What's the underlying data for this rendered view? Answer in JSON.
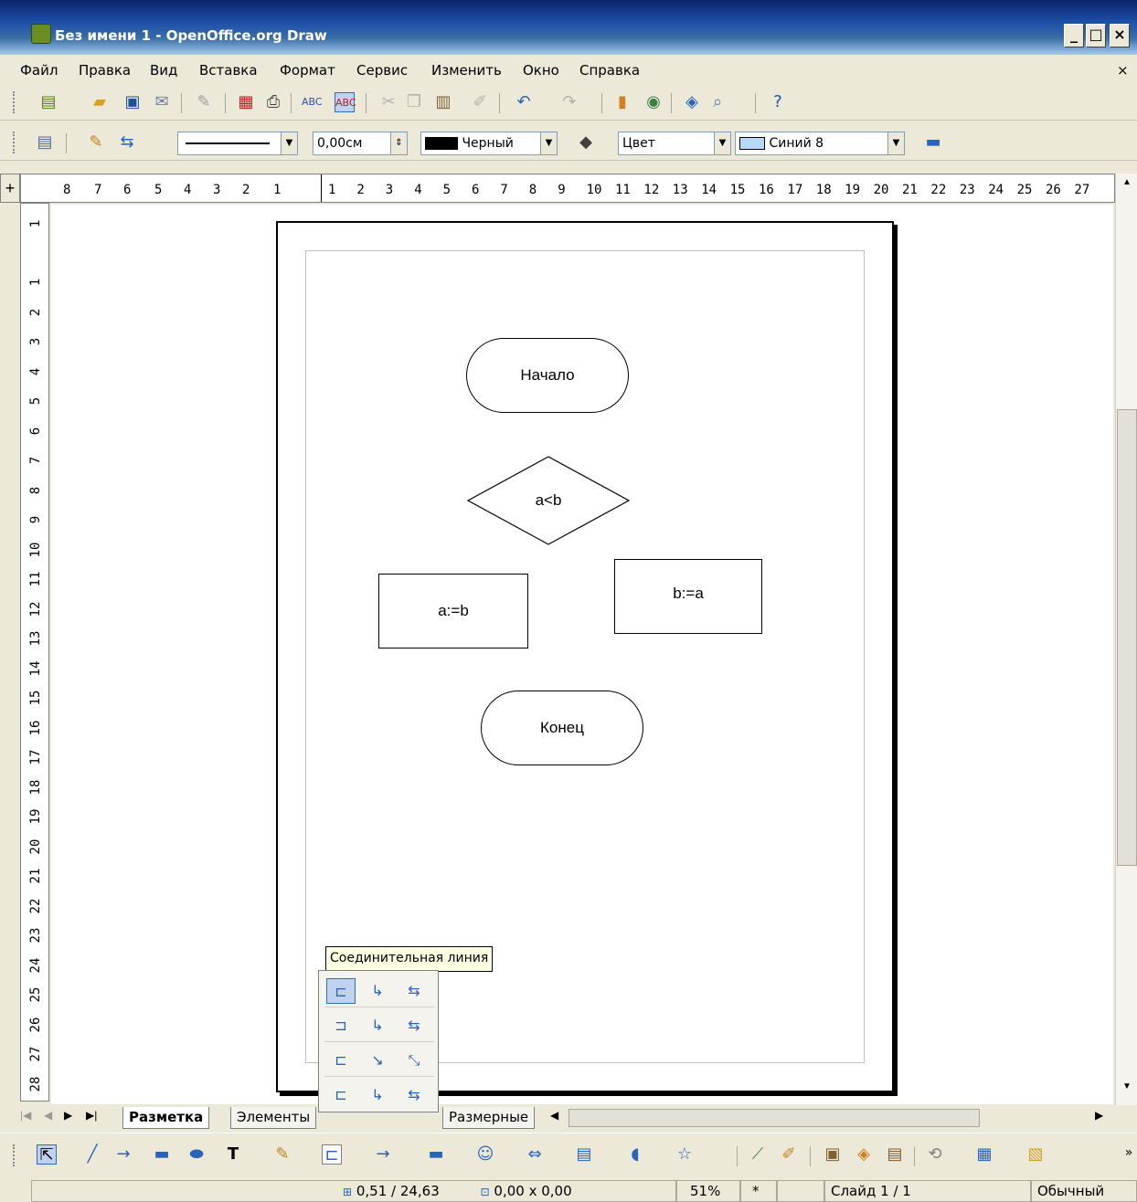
{
  "window": {
    "title": "Без имени 1 - OpenOffice.org Draw",
    "min_btn": "_",
    "max_btn": "□",
    "close_btn": "×"
  },
  "menu": {
    "items": [
      "Файл",
      "Правка",
      "Вид",
      "Вставка",
      "Формат",
      "Сервис",
      "Изменить",
      "Окно",
      "Справка"
    ],
    "close": "×"
  },
  "line_toolbar": {
    "line_width": "0,00см",
    "line_color": "Черный",
    "area_style": "Цвет",
    "area_color": "Синий 8"
  },
  "ruler": {
    "h_left": [
      "8",
      "7",
      "6",
      "5",
      "4",
      "3",
      "2",
      "1"
    ],
    "h_right": [
      "1",
      "2",
      "3",
      "4",
      "5",
      "6",
      "7",
      "8",
      "9",
      "10",
      "11",
      "12",
      "13",
      "14",
      "15",
      "16",
      "17",
      "18",
      "19",
      "20",
      "21",
      "22",
      "23",
      "24",
      "25",
      "26",
      "27"
    ],
    "v": [
      "1",
      "1",
      "2",
      "3",
      "4",
      "5",
      "6",
      "7",
      "8",
      "9",
      "10",
      "11",
      "12",
      "13",
      "14",
      "15",
      "16",
      "17",
      "18",
      "19",
      "20",
      "21",
      "22",
      "23",
      "24",
      "25",
      "26",
      "27",
      "28"
    ]
  },
  "shapes": {
    "start": "Начало",
    "decision": "a<b",
    "assign_a": "a:=b",
    "assign_b": "b:=a",
    "end": "Конец"
  },
  "connector_popup": {
    "tooltip": "Соединительная линия"
  },
  "tabs": {
    "layout": "Разметка",
    "controls": "Элементы",
    "dimensions": "Размерные"
  },
  "status": {
    "position": "0,51 / 24,63",
    "size": "0,00 x 0,00",
    "zoom": "51%",
    "modified": "*",
    "slide": "Слайд 1 / 1",
    "style": "Обычный"
  }
}
